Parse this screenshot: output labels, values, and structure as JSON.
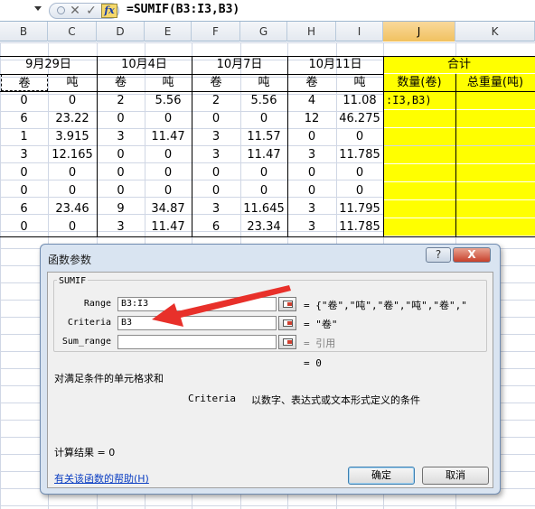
{
  "formula_bar": {
    "formula": "=SUMIF(B3:I3,B3)",
    "cancel_icon": "x-icon",
    "enter_icon": "check-icon",
    "fx_label": "fx"
  },
  "columns": [
    "B",
    "C",
    "D",
    "E",
    "F",
    "G",
    "H",
    "I",
    "J",
    "K"
  ],
  "selected_column": "J",
  "sheet": {
    "date_headers": [
      "9月29日",
      "10月4日",
      "10月7日",
      "10月11日"
    ],
    "total_header": "合计",
    "unit_juan": "卷",
    "unit_dun": "吨",
    "count_header": "数量(卷)",
    "weight_header": "总重量(吨)",
    "editing_text": ":I3,B3)",
    "rows": [
      [
        "0",
        "0",
        "2",
        "5.56",
        "2",
        "5.56",
        "4",
        "11.08"
      ],
      [
        "6",
        "23.22",
        "0",
        "0",
        "0",
        "0",
        "12",
        "46.275"
      ],
      [
        "1",
        "3.915",
        "3",
        "11.47",
        "3",
        "11.57",
        "0",
        "0"
      ],
      [
        "3",
        "12.165",
        "0",
        "0",
        "3",
        "11.47",
        "3",
        "11.785"
      ],
      [
        "0",
        "0",
        "0",
        "0",
        "0",
        "0",
        "0",
        "0"
      ],
      [
        "0",
        "0",
        "0",
        "0",
        "0",
        "0",
        "0",
        "0"
      ],
      [
        "6",
        "23.46",
        "9",
        "34.87",
        "3",
        "11.645",
        "3",
        "11.795"
      ],
      [
        "0",
        "0",
        "3",
        "11.47",
        "6",
        "23.34",
        "3",
        "11.785"
      ]
    ]
  },
  "dialog": {
    "title": "函数参数",
    "help_btn": "?",
    "close_btn": "X",
    "function_name": "SUMIF",
    "args": [
      {
        "label": "Range",
        "value": "B3:I3",
        "result": "= {\"卷\",\"吨\",\"卷\",\"吨\",\"卷\",\"",
        "muted": false
      },
      {
        "label": "Criteria",
        "value": "B3",
        "result": "= \"卷\"",
        "muted": false
      },
      {
        "label": "Sum_range",
        "value": "",
        "result": "= 引用",
        "muted": true
      }
    ],
    "result_line": "= 0",
    "description": "对满足条件的单元格求和",
    "arg_description_name": "Criteria",
    "arg_description": "以数字、表达式或文本形式定义的条件",
    "calc_result": "计算结果 = 0",
    "help_link": "有关该函数的帮助(H)",
    "ok": "确定",
    "cancel": "取消"
  },
  "annotation": {
    "arrow_color": "#e8302a"
  }
}
